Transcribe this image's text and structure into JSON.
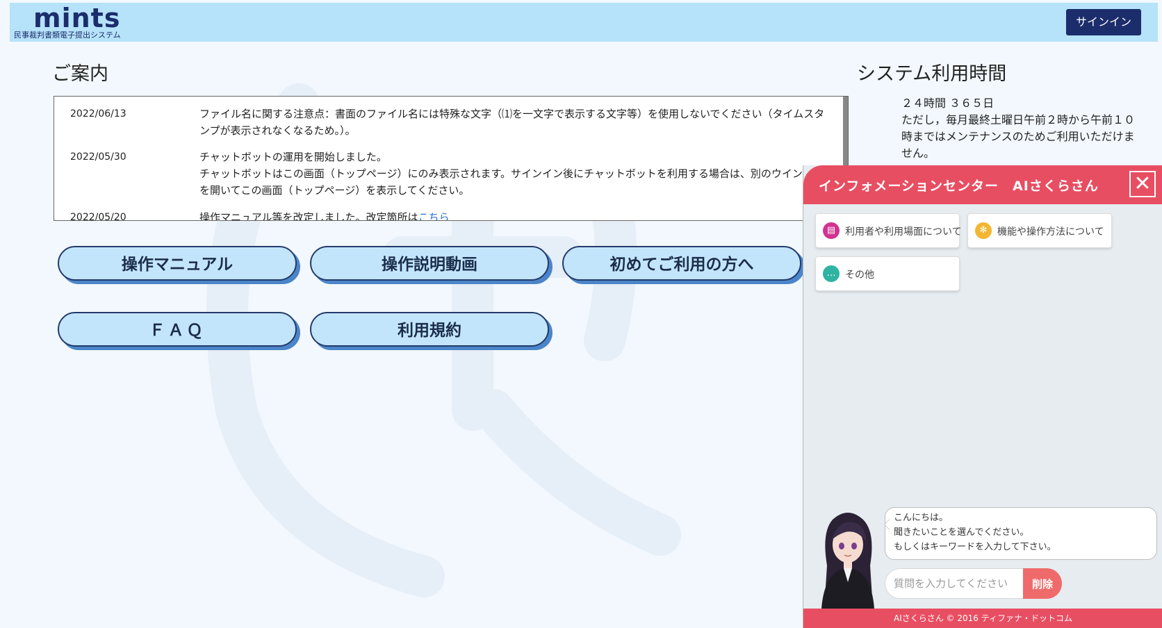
{
  "header": {
    "logo_main": "mints",
    "logo_sub": "民事裁判書類電子提出システム",
    "signin_label": "サインイン"
  },
  "notice": {
    "title": "ご案内",
    "items": [
      {
        "date": "2022/06/13",
        "text": "ファイル名に関する注意点：書面のファイル名には特殊な文字（⑴を一文字で表示する文字等）を使用しないでください（タイムスタンプが表示されなくなるため。）。"
      },
      {
        "date": "2022/05/30",
        "text": "チャットボットの運用を開始しました。",
        "text2": "チャットボットはこの画面（トップページ）にのみ表示されます。サインイン後にチャットボットを利用する場合は、別のウインドウを開いてこの画面（トップページ）を表示してください。"
      },
      {
        "date": "2022/05/20",
        "text": "操作マニュアル等を改定しました。改定箇所は",
        "link": "こちら"
      }
    ]
  },
  "links": {
    "manual": "操作マニュアル",
    "video": "操作説明動画",
    "first_time": "初めてご利用の方へ",
    "faq": "ＦＡＱ",
    "terms": "利用規約"
  },
  "systime": {
    "title": "システム利用時間",
    "line1": "２４時間 ３６５日",
    "line2": "ただし，毎月最終土曜日午前２時から午前１０時まではメンテナンスのためご利用いただけません。"
  },
  "chat": {
    "title": "インフォメーションセンター　AIさくらさん",
    "categories": [
      {
        "label": "利用者や利用場面について",
        "icon": "book-icon",
        "color": "#d1328f"
      },
      {
        "label": "機能や操作方法について",
        "icon": "gear-icon",
        "color": "#f2b632"
      },
      {
        "label": "その他",
        "icon": "more-icon",
        "color": "#2fb3a3"
      }
    ],
    "greeting": [
      "こんにちは。",
      "聞きたいことを選んでください。",
      "もしくはキーワードを入力して下さい。"
    ],
    "input_placeholder": "質問を入力してください",
    "delete_label": "削除",
    "footer": "AIさくらさん © 2016 ティファナ・ドットコム"
  }
}
